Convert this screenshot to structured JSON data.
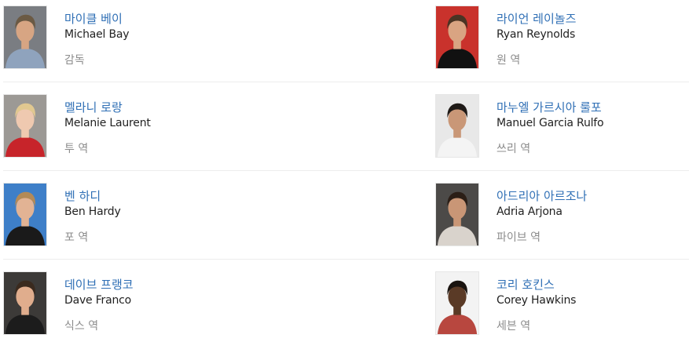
{
  "cast": [
    {
      "name_ko": "마이클 베이",
      "name_en": "Michael Bay",
      "role": "감독",
      "photo": "michael-bay-photo",
      "bg": "#7a7d82",
      "skin": "#d7a583",
      "hair": "#6b5a44",
      "shirt": "#8fa3bd"
    },
    {
      "name_ko": "라이언 레이놀즈",
      "name_en": "Ryan Reynolds",
      "role": "원 역",
      "photo": "ryan-reynolds-photo",
      "bg": "#c9322c",
      "skin": "#d9a482",
      "hair": "#4a3424",
      "shirt": "#111111"
    },
    {
      "name_ko": "멜라니 로랑",
      "name_en": "Melanie Laurent",
      "role": "투 역",
      "photo": "melanie-laurent-photo",
      "bg": "#9c9995",
      "skin": "#efc9b0",
      "hair": "#e1c890",
      "shirt": "#c7242a"
    },
    {
      "name_ko": "마누엘 가르시아 룰포",
      "name_en": "Manuel Garcia Rulfo",
      "role": "쓰리 역",
      "photo": "manuel-garcia-rulfo-photo",
      "bg": "#e8e8e8",
      "skin": "#c99777",
      "hair": "#1f1a17",
      "shirt": "#f4f4f4"
    },
    {
      "name_ko": "벤 하디",
      "name_en": "Ben Hardy",
      "role": "포 역",
      "photo": "ben-hardy-photo",
      "bg": "#3e7fc8",
      "skin": "#e2b394",
      "hair": "#b38a57",
      "shirt": "#1a1a1a"
    },
    {
      "name_ko": "아드리아 아르조나",
      "name_en": "Adria Arjona",
      "role": "파이브 역",
      "photo": "adria-arjona-photo",
      "bg": "#4c4a48",
      "skin": "#c99676",
      "hair": "#2b1e16",
      "shirt": "#d9d3cc"
    },
    {
      "name_ko": "데이브 프랭코",
      "name_en": "Dave Franco",
      "role": "식스 역",
      "photo": "dave-franco-photo",
      "bg": "#3c3a38",
      "skin": "#e0ad8d",
      "hair": "#3a2a1e",
      "shirt": "#1c1c1c"
    },
    {
      "name_ko": "코리 호킨스",
      "name_en": "Corey Hawkins",
      "role": "세븐 역",
      "photo": "corey-hawkins-photo",
      "bg": "#f3f3f3",
      "skin": "#5a3a26",
      "hair": "#1a1410",
      "shirt": "#b8473f"
    }
  ]
}
